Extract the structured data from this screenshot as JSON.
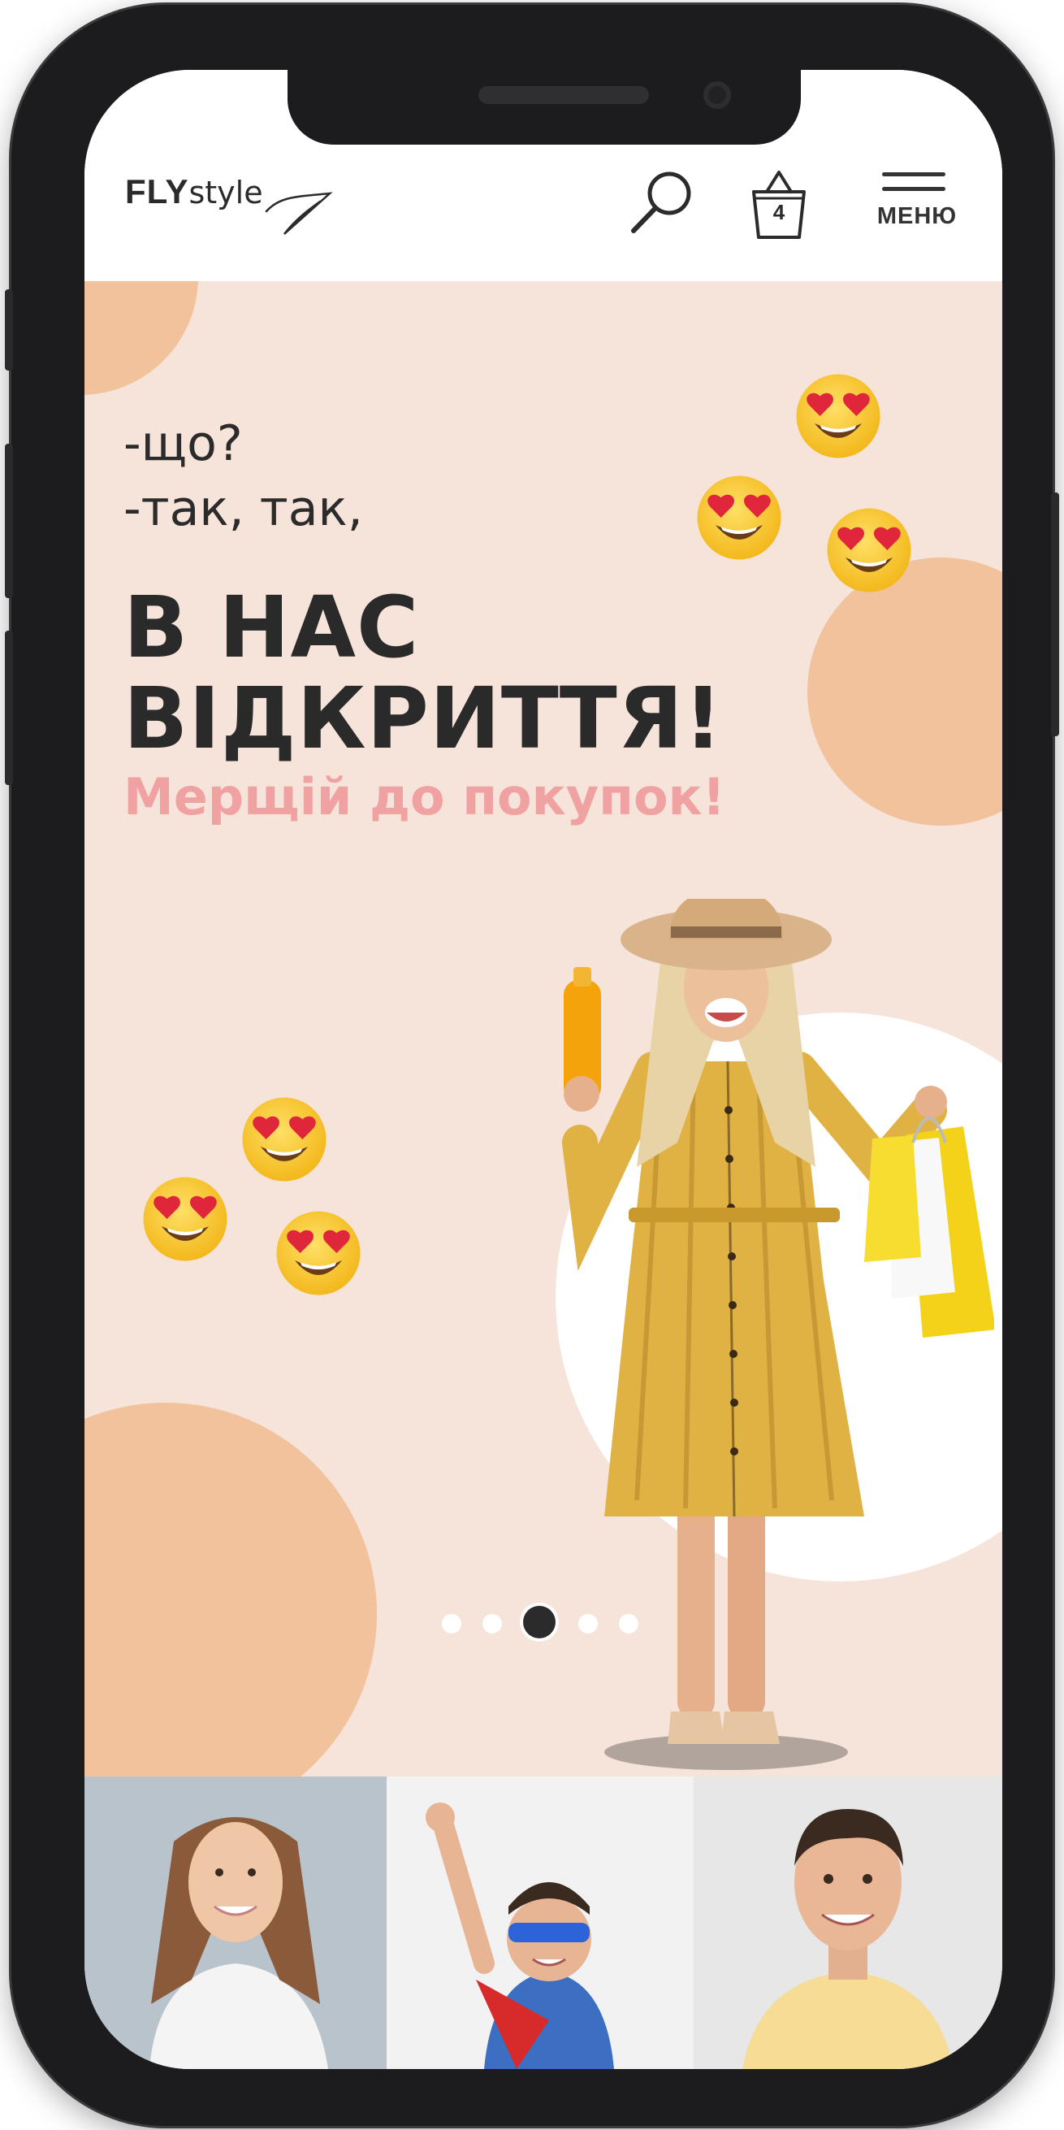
{
  "header": {
    "logo": {
      "bold": "FLY",
      "light": "style"
    },
    "cart_count": "4",
    "menu_label": "МЕНЮ"
  },
  "hero": {
    "line1": "-що?",
    "line2": "-так, так,",
    "headline_1": "В НАС",
    "headline_2": "ВІДКРИТТЯ!",
    "tagline": "Мерщій до покупок!",
    "slider": {
      "slides": 5,
      "active_index": 2
    }
  },
  "categories": [
    {
      "name": "women"
    },
    {
      "name": "kids"
    },
    {
      "name": "men"
    }
  ],
  "colors": {
    "hero_background": "#f6e3d9",
    "accent_circle": "#f1c29c",
    "tagline": "#f0a1a1",
    "text_dark": "#2a2a2a",
    "dress": "#e0b244",
    "bags": "#f5d21a"
  },
  "icons": [
    "search-icon",
    "basket-icon",
    "hamburger-icon",
    "heart-eyes-emoji-icon"
  ]
}
